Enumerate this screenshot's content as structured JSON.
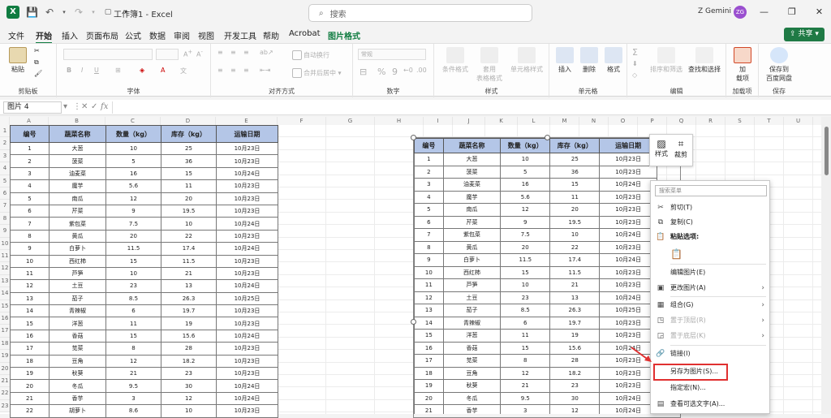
{
  "app": {
    "title": "工作簿1 - Excel",
    "search_placeholder": "搜索",
    "user_name": "Z Gemini",
    "user_initials": "ZG",
    "brand_color": "#107c41"
  },
  "menu": {
    "items": [
      "文件",
      "开始",
      "插入",
      "页面布局",
      "公式",
      "数据",
      "审阅",
      "视图",
      "开发工具",
      "帮助",
      "Acrobat",
      "图片格式"
    ],
    "active": "开始",
    "share_label": "共享"
  },
  "ribbon": {
    "groups": [
      "剪贴板",
      "字体",
      "对齐方式",
      "数字",
      "样式",
      "单元格",
      "编辑",
      "加载项",
      "保存"
    ],
    "paste_label": "粘贴",
    "wrap_label": "自动换行",
    "merge_label": "合并后居中",
    "number_format": "常规",
    "cond_format": "条件格式",
    "table_format": "套用\n表格格式",
    "cell_style": "单元格样式",
    "insert": "插入",
    "delete": "删除",
    "format": "格式",
    "sort_filter": "排序和筛选",
    "find_select": "查找和选择",
    "addins": "加\n载项",
    "save_to": "保存到\n百度网盘"
  },
  "formula": {
    "name_box": "图片 4",
    "fx": "fx"
  },
  "columns": [
    "A",
    "B",
    "C",
    "D",
    "E",
    "F",
    "G",
    "H",
    "I",
    "J",
    "K",
    "L",
    "M",
    "N",
    "O",
    "P",
    "Q",
    "R",
    "S",
    "T",
    "U",
    "V",
    "W"
  ],
  "rows": [
    "1",
    "2",
    "3",
    "4",
    "5",
    "6",
    "7",
    "8",
    "9",
    "10",
    "11",
    "12",
    "13",
    "14",
    "15",
    "16",
    "17",
    "18",
    "19",
    "20",
    "21",
    "22",
    "23"
  ],
  "table": {
    "headers": [
      "编号",
      "蔬菜名称",
      "数量（kg）",
      "库存（kg）",
      "运输日期"
    ],
    "rows": [
      [
        "1",
        "大葱",
        "10",
        "25",
        "10月23日"
      ],
      [
        "2",
        "菠菜",
        "5",
        "36",
        "10月23日"
      ],
      [
        "3",
        "油麦菜",
        "16",
        "15",
        "10月24日"
      ],
      [
        "4",
        "魔芋",
        "5.6",
        "11",
        "10月23日"
      ],
      [
        "5",
        "南瓜",
        "12",
        "20",
        "10月23日"
      ],
      [
        "6",
        "芹菜",
        "9",
        "19.5",
        "10月23日"
      ],
      [
        "7",
        "紫包菜",
        "7.5",
        "10",
        "10月24日"
      ],
      [
        "8",
        "黄瓜",
        "20",
        "22",
        "10月23日"
      ],
      [
        "9",
        "白萝卜",
        "11.5",
        "17.4",
        "10月24日"
      ],
      [
        "10",
        "西红柿",
        "15",
        "11.5",
        "10月23日"
      ],
      [
        "11",
        "芦笋",
        "10",
        "21",
        "10月23日"
      ],
      [
        "12",
        "土豆",
        "23",
        "13",
        "10月24日"
      ],
      [
        "13",
        "茄子",
        "8.5",
        "26.3",
        "10月25日"
      ],
      [
        "14",
        "青辣椒",
        "6",
        "19.7",
        "10月23日"
      ],
      [
        "15",
        "洋葱",
        "11",
        "19",
        "10月23日"
      ],
      [
        "16",
        "香菇",
        "15",
        "15.6",
        "10月24日"
      ],
      [
        "17",
        "苋菜",
        "8",
        "28",
        "10月23日"
      ],
      [
        "18",
        "豆角",
        "12",
        "18.2",
        "10月23日"
      ],
      [
        "19",
        "秋葵",
        "21",
        "23",
        "10月23日"
      ],
      [
        "20",
        "冬瓜",
        "9.5",
        "30",
        "10月24日"
      ],
      [
        "21",
        "香芋",
        "3",
        "12",
        "10月24日"
      ],
      [
        "22",
        "胡萝卜",
        "8.6",
        "10",
        "10月23日"
      ]
    ]
  },
  "mini_toolbar": {
    "style": "样式",
    "crop": "裁剪"
  },
  "context_menu": {
    "search": "搜索菜单",
    "items": [
      {
        "label": "剪切(T)",
        "icon": "scissors-icon",
        "dim": false
      },
      {
        "label": "复制(C)",
        "icon": "copy-icon",
        "dim": false
      },
      {
        "label": "粘贴选项:",
        "icon": "paste-icon",
        "dim": false
      },
      {
        "label": "",
        "icon": "paste-option-icon",
        "dim": false
      },
      {
        "label": "编辑图片(E)",
        "icon": "",
        "dim": false
      },
      {
        "label": "更改图片(A)",
        "icon": "change-picture-icon",
        "dim": false,
        "arrow": true
      },
      {
        "label": "组合(G)",
        "icon": "group-icon",
        "dim": false,
        "arrow": true
      },
      {
        "label": "置于顶层(R)",
        "icon": "bring-front-icon",
        "dim": true,
        "arrow": true
      },
      {
        "label": "置于底层(K)",
        "icon": "send-back-icon",
        "dim": true,
        "arrow": true
      },
      {
        "label": "链接(I)",
        "icon": "link-icon",
        "dim": false
      },
      {
        "label": "另存为图片(S)...",
        "icon": "",
        "dim": false
      },
      {
        "label": "指定宏(N)...",
        "icon": "",
        "dim": false
      },
      {
        "label": "查看可选文字(A)...",
        "icon": "alt-text-icon",
        "dim": false
      }
    ]
  }
}
